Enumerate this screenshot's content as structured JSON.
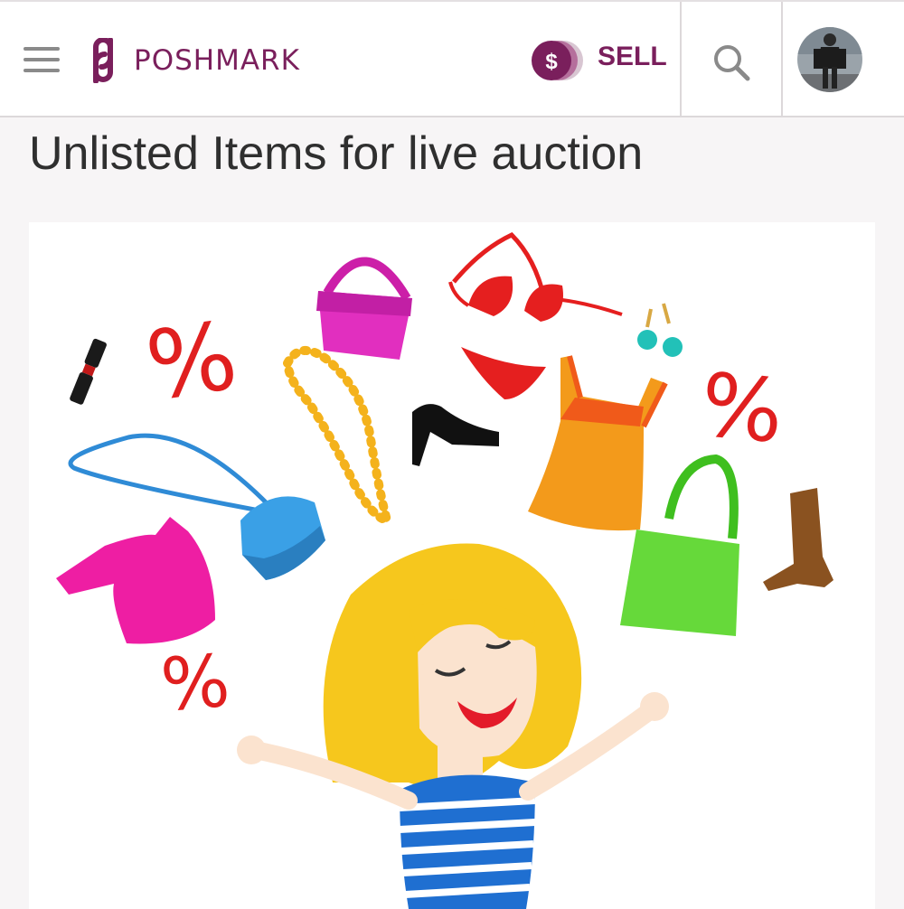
{
  "header": {
    "brand": "POSHMARK",
    "sell_label": "SELL",
    "sell_badge": "$",
    "menu_icon": "hamburger-icon",
    "search_icon": "search-icon",
    "avatar_icon": "avatar"
  },
  "page": {
    "title": "Unlisted Items for live auction"
  },
  "illustration": {
    "symbols": [
      "%",
      "%",
      "%"
    ]
  },
  "colors": {
    "brand": "#7a1f5c",
    "sale_red": "#e01f1f"
  }
}
